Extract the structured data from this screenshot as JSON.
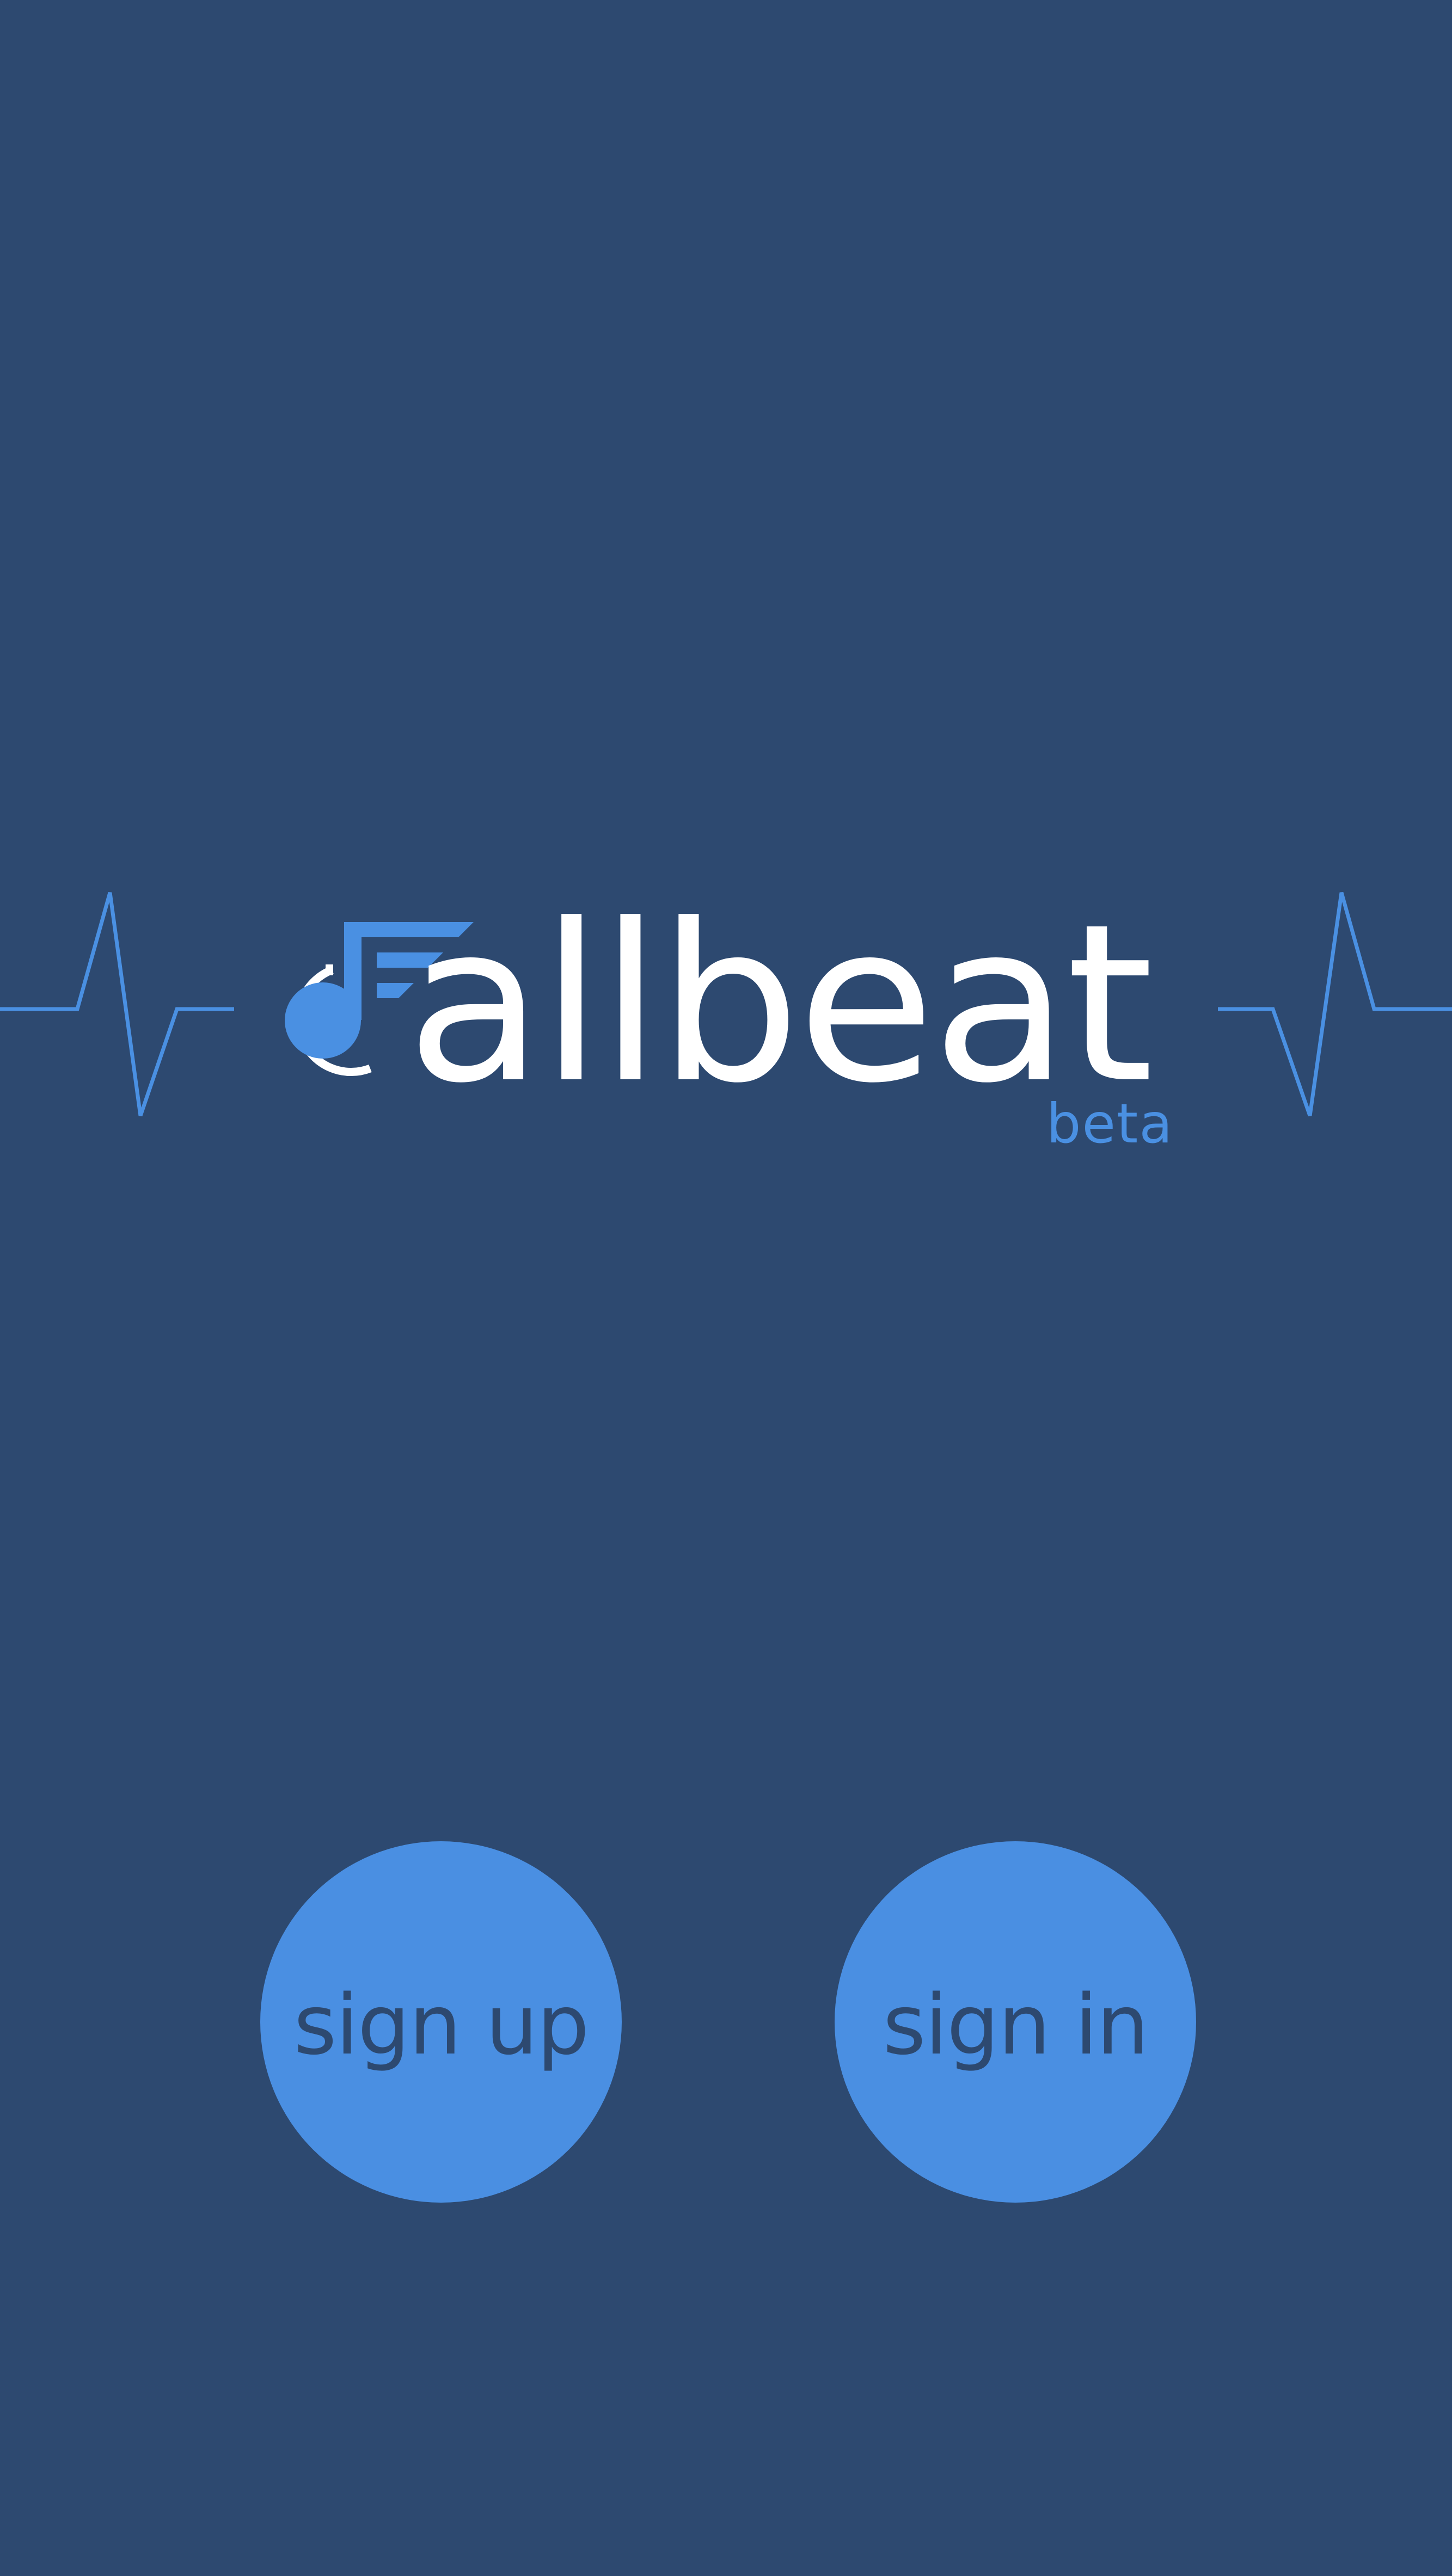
{
  "app": {
    "name": "callbeat",
    "wordmark_rest": "allbeat",
    "badge": "beta"
  },
  "actions": {
    "sign_up_label": "sign up",
    "sign_in_label": "sign in"
  },
  "icons": {
    "logo_mark": "music-note-c-icon",
    "left_decoration": "heartbeat-line-icon",
    "right_decoration": "heartbeat-line-icon"
  },
  "colors": {
    "background": "#2d4970",
    "accent": "#4a90e2",
    "wordmark": "#ffffff",
    "button_text": "#2d4970"
  }
}
